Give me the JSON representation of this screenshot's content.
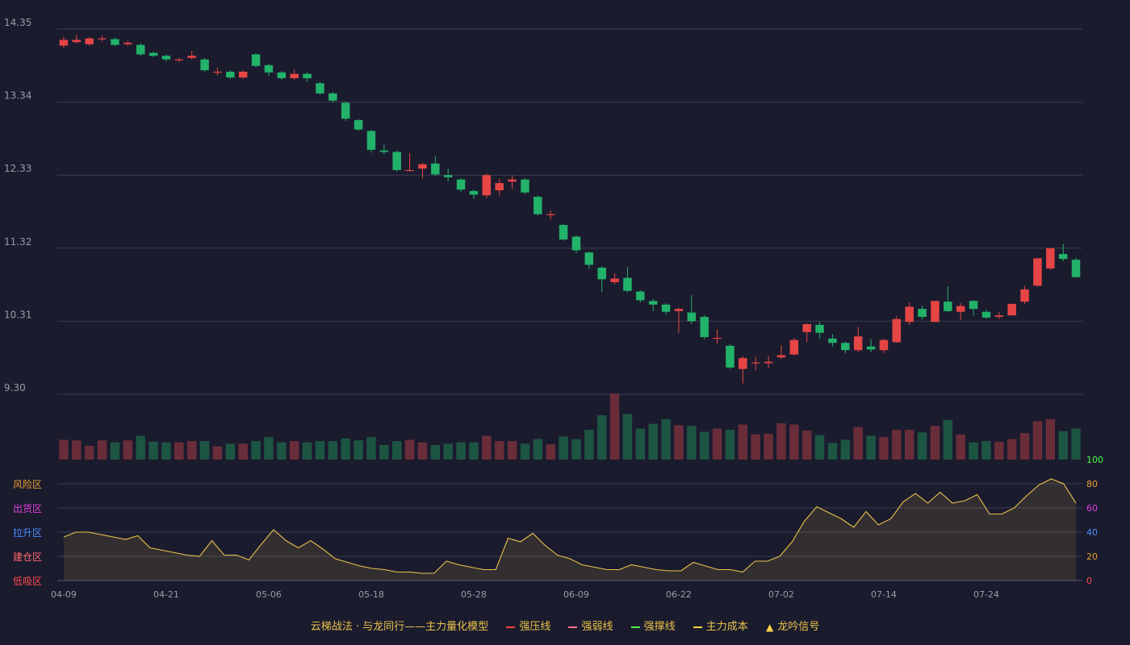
{
  "chart_data": {
    "type": "candlestick",
    "price_axis": {
      "ticks": [
        "14.35",
        "13.34",
        "12.33",
        "11.32",
        "10.31",
        "9.30"
      ],
      "ylim": [
        9.3,
        14.35
      ]
    },
    "x_ticks": [
      {
        "index": 0,
        "label": "04-09"
      },
      {
        "index": 8,
        "label": "04-21"
      },
      {
        "index": 16,
        "label": "05-06"
      },
      {
        "index": 24,
        "label": "05-18"
      },
      {
        "index": 32,
        "label": "05-28"
      },
      {
        "index": 40,
        "label": "06-09"
      },
      {
        "index": 48,
        "label": "06-22"
      },
      {
        "index": 56,
        "label": "07-02"
      },
      {
        "index": 64,
        "label": "07-14"
      },
      {
        "index": 72,
        "label": "07-24"
      }
    ],
    "candles": [
      [
        14.12,
        14.2,
        14.24,
        14.08
      ],
      [
        14.17,
        14.2,
        14.27,
        14.15
      ],
      [
        14.14,
        14.22,
        14.24,
        14.12
      ],
      [
        14.22,
        14.22,
        14.26,
        14.18
      ],
      [
        14.21,
        14.13,
        14.23,
        14.11
      ],
      [
        14.14,
        14.16,
        14.19,
        14.12
      ],
      [
        14.13,
        14.0,
        14.15,
        13.98
      ],
      [
        14.02,
        13.98,
        14.04,
        13.96
      ],
      [
        13.98,
        13.93,
        14.0,
        13.9
      ],
      [
        13.93,
        13.93,
        13.95,
        13.89
      ],
      [
        13.95,
        13.98,
        14.05,
        13.93
      ],
      [
        13.93,
        13.78,
        13.95,
        13.76
      ],
      [
        13.76,
        13.76,
        13.82,
        13.71
      ],
      [
        13.76,
        13.68,
        13.78,
        13.66
      ],
      [
        13.68,
        13.76,
        13.78,
        13.66
      ],
      [
        14.0,
        13.84,
        14.02,
        13.82
      ],
      [
        13.85,
        13.75,
        13.87,
        13.7
      ],
      [
        13.75,
        13.67,
        13.77,
        13.65
      ],
      [
        13.67,
        13.73,
        13.79,
        13.65
      ],
      [
        13.73,
        13.67,
        13.75,
        13.62
      ],
      [
        13.6,
        13.46,
        13.62,
        13.44
      ],
      [
        13.46,
        13.36,
        13.48,
        13.33
      ],
      [
        13.33,
        13.11,
        13.35,
        13.08
      ],
      [
        13.09,
        12.96,
        13.11,
        12.94
      ],
      [
        12.94,
        12.68,
        12.96,
        12.64
      ],
      [
        12.67,
        12.65,
        12.76,
        12.62
      ],
      [
        12.65,
        12.4,
        12.67,
        12.38
      ],
      [
        12.4,
        12.4,
        12.63,
        12.38
      ],
      [
        12.42,
        12.48,
        12.5,
        12.28
      ],
      [
        12.49,
        12.34,
        12.59,
        12.31
      ],
      [
        12.33,
        12.3,
        12.42,
        12.24
      ],
      [
        12.27,
        12.13,
        12.29,
        12.1
      ],
      [
        12.11,
        12.06,
        12.13,
        12.0
      ],
      [
        12.05,
        12.33,
        12.35,
        12.01
      ],
      [
        12.12,
        12.22,
        12.28,
        12.05
      ],
      [
        12.24,
        12.27,
        12.33,
        12.14
      ],
      [
        12.27,
        12.09,
        12.29,
        12.07
      ],
      [
        12.03,
        11.79,
        12.05,
        11.77
      ],
      [
        11.79,
        11.79,
        11.84,
        11.72
      ],
      [
        11.64,
        11.44,
        11.66,
        11.42
      ],
      [
        11.48,
        11.29,
        11.5,
        11.25
      ],
      [
        11.26,
        11.09,
        11.27,
        11.03
      ],
      [
        11.05,
        10.89,
        11.07,
        10.71
      ],
      [
        10.85,
        10.9,
        10.97,
        10.82
      ],
      [
        10.91,
        10.73,
        11.06,
        10.71
      ],
      [
        10.72,
        10.6,
        10.74,
        10.57
      ],
      [
        10.59,
        10.54,
        10.62,
        10.45
      ],
      [
        10.54,
        10.44,
        10.56,
        10.4
      ],
      [
        10.45,
        10.48,
        10.5,
        10.15
      ],
      [
        10.43,
        10.31,
        10.67,
        10.27
      ],
      [
        10.37,
        10.09,
        10.4,
        10.06
      ],
      [
        10.08,
        10.08,
        10.2,
        10.0
      ],
      [
        9.97,
        9.67,
        9.99,
        9.65
      ],
      [
        9.65,
        9.8,
        9.83,
        9.45
      ],
      [
        9.74,
        9.74,
        9.82,
        9.63
      ],
      [
        9.73,
        9.75,
        9.83,
        9.66
      ],
      [
        9.81,
        9.84,
        9.98,
        9.79
      ],
      [
        9.85,
        10.05,
        10.08,
        9.84
      ],
      [
        10.16,
        10.27,
        10.28,
        10.02
      ],
      [
        10.26,
        10.15,
        10.3,
        10.07
      ],
      [
        10.07,
        10.01,
        10.13,
        9.96
      ],
      [
        10.01,
        9.91,
        10.03,
        9.87
      ],
      [
        9.91,
        10.1,
        10.23,
        9.88
      ],
      [
        9.96,
        9.92,
        10.06,
        9.88
      ],
      [
        9.91,
        10.05,
        10.07,
        9.87
      ],
      [
        10.02,
        10.34,
        10.38,
        10.01
      ],
      [
        10.3,
        10.51,
        10.57,
        10.26
      ],
      [
        10.48,
        10.37,
        10.52,
        10.33
      ],
      [
        10.3,
        10.59,
        10.59,
        10.3
      ],
      [
        10.58,
        10.45,
        10.79,
        10.44
      ],
      [
        10.44,
        10.52,
        10.56,
        10.33
      ],
      [
        10.59,
        10.48,
        10.6,
        10.39
      ],
      [
        10.44,
        10.36,
        10.47,
        10.34
      ],
      [
        10.37,
        10.39,
        10.44,
        10.34
      ],
      [
        10.39,
        10.55,
        10.55,
        10.39
      ],
      [
        10.58,
        10.75,
        10.8,
        10.55
      ],
      [
        10.8,
        11.18,
        11.18,
        10.79
      ],
      [
        11.04,
        11.32,
        11.32,
        11.02
      ],
      [
        11.24,
        11.17,
        11.38,
        11.14
      ],
      [
        11.16,
        10.92,
        11.19,
        10.91
      ]
    ],
    "volumes": [
      0.3,
      0.29,
      0.21,
      0.29,
      0.26,
      0.29,
      0.36,
      0.27,
      0.26,
      0.26,
      0.28,
      0.28,
      0.2,
      0.24,
      0.24,
      0.28,
      0.34,
      0.26,
      0.28,
      0.26,
      0.28,
      0.28,
      0.32,
      0.29,
      0.34,
      0.22,
      0.28,
      0.3,
      0.26,
      0.22,
      0.24,
      0.26,
      0.26,
      0.36,
      0.28,
      0.28,
      0.24,
      0.31,
      0.23,
      0.35,
      0.31,
      0.45,
      0.67,
      1.0,
      0.69,
      0.47,
      0.54,
      0.61,
      0.52,
      0.51,
      0.42,
      0.47,
      0.45,
      0.53,
      0.38,
      0.39,
      0.55,
      0.53,
      0.44,
      0.37,
      0.25,
      0.3,
      0.49,
      0.36,
      0.34,
      0.45,
      0.45,
      0.41,
      0.51,
      0.6,
      0.38,
      0.26,
      0.28,
      0.27,
      0.31,
      0.4,
      0.58,
      0.61,
      0.43,
      0.47
    ],
    "oscillator": {
      "axis_ticks": [
        "100",
        "80",
        "60",
        "40",
        "20",
        "0"
      ],
      "zones": [
        "风险区",
        "出货区",
        "拉升区",
        "建仓区",
        "低吸区"
      ],
      "values": [
        36,
        40,
        40,
        38,
        36,
        34,
        37,
        27,
        25,
        23,
        21,
        20,
        33,
        21,
        21,
        17,
        30,
        42,
        33,
        27,
        33,
        26,
        18,
        15,
        12,
        10,
        9,
        7,
        7,
        6,
        6,
        16,
        13,
        11,
        9,
        9,
        35,
        32,
        39,
        29,
        21,
        18,
        13,
        11,
        9,
        9,
        13,
        11,
        9,
        8,
        8,
        15,
        12,
        9,
        9,
        7,
        16,
        16,
        20,
        32,
        49,
        61,
        56,
        51,
        44,
        57,
        46,
        51,
        65,
        72,
        64,
        73,
        64,
        66,
        71,
        55,
        55,
        60,
        70,
        79,
        84,
        80,
        64
      ]
    },
    "colors": {
      "up": "#e64545",
      "down": "#22b26a",
      "line": "#e8c34a"
    }
  },
  "legend": {
    "model_label": "云梯战法 · 与龙同行——主力量化模型",
    "items": [
      {
        "label": "强压线",
        "color": "#ff4040",
        "style": "solid"
      },
      {
        "label": "强弱线",
        "color": "#ff6a8a",
        "style": "dashed"
      },
      {
        "label": "强撑线",
        "color": "#4aff4a",
        "style": "solid"
      },
      {
        "label": "主力成本",
        "color": "#ffd54a",
        "style": "dashed"
      },
      {
        "label": "龙吟信号",
        "color": "#ffd54a",
        "style": "triangle",
        "icon": "triangle-up-icon"
      }
    ]
  }
}
